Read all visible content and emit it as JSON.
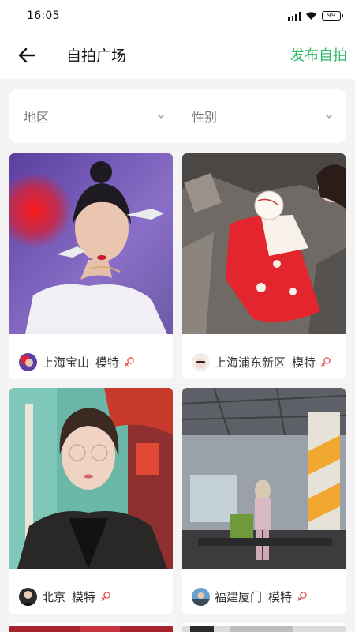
{
  "status": {
    "time": "16:05",
    "battery": "99"
  },
  "header": {
    "title": "自拍广场",
    "publish": "发布自拍"
  },
  "filters": [
    {
      "label": "地区"
    },
    {
      "label": "性别"
    }
  ],
  "colors": {
    "accent": "#2dbb68",
    "gender_female": "#e24d4d"
  },
  "cards": [
    {
      "region": "上海宝山",
      "role": "模特",
      "gender": "female-icon"
    },
    {
      "region": "上海浦东新区",
      "role": "模特",
      "gender": "female-icon"
    },
    {
      "region": "北京",
      "role": "模特",
      "gender": "female-icon"
    },
    {
      "region": "福建厦门",
      "role": "模特",
      "gender": "female-icon"
    }
  ]
}
